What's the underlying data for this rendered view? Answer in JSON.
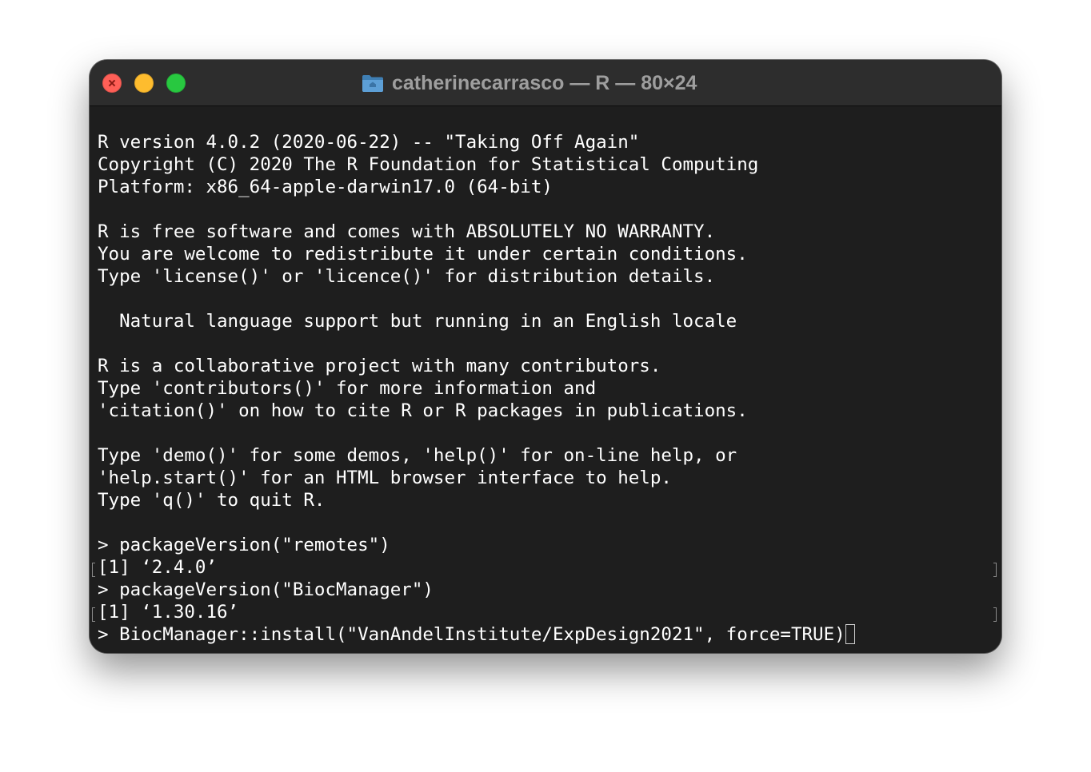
{
  "window": {
    "title": "catherinecarrasco — R — 80×24",
    "title_icon": "folder-home-icon",
    "traffic_lights": [
      "close",
      "minimize",
      "zoom"
    ],
    "colors": {
      "close": "#fe5f57",
      "minimize": "#febc2e",
      "zoom": "#28c840",
      "terminal_bg": "#1e1e1e",
      "titlebar_bg": "#2d2d2d",
      "text": "#ffffff"
    }
  },
  "terminal": {
    "lines": [
      "R version 4.0.2 (2020-06-22) -- \"Taking Off Again\"",
      "Copyright (C) 2020 The R Foundation for Statistical Computing",
      "Platform: x86_64-apple-darwin17.0 (64-bit)",
      "",
      "R is free software and comes with ABSOLUTELY NO WARRANTY.",
      "You are welcome to redistribute it under certain conditions.",
      "Type 'license()' or 'licence()' for distribution details.",
      "",
      "  Natural language support but running in an English locale",
      "",
      "R is a collaborative project with many contributors.",
      "Type 'contributors()' for more information and",
      "'citation()' on how to cite R or R packages in publications.",
      "",
      "Type 'demo()' for some demos, 'help()' for on-line help, or",
      "'help.start()' for an HTML browser interface to help.",
      "Type 'q()' to quit R.",
      "",
      "> packageVersion(\"remotes\")",
      "[1] ‘2.4.0’",
      "> packageVersion(\"BiocManager\")",
      "[1] ‘1.30.16’",
      "> BiocManager::install(\"VanAndelInstitute/ExpDesign2021\", force=TRUE)"
    ]
  }
}
